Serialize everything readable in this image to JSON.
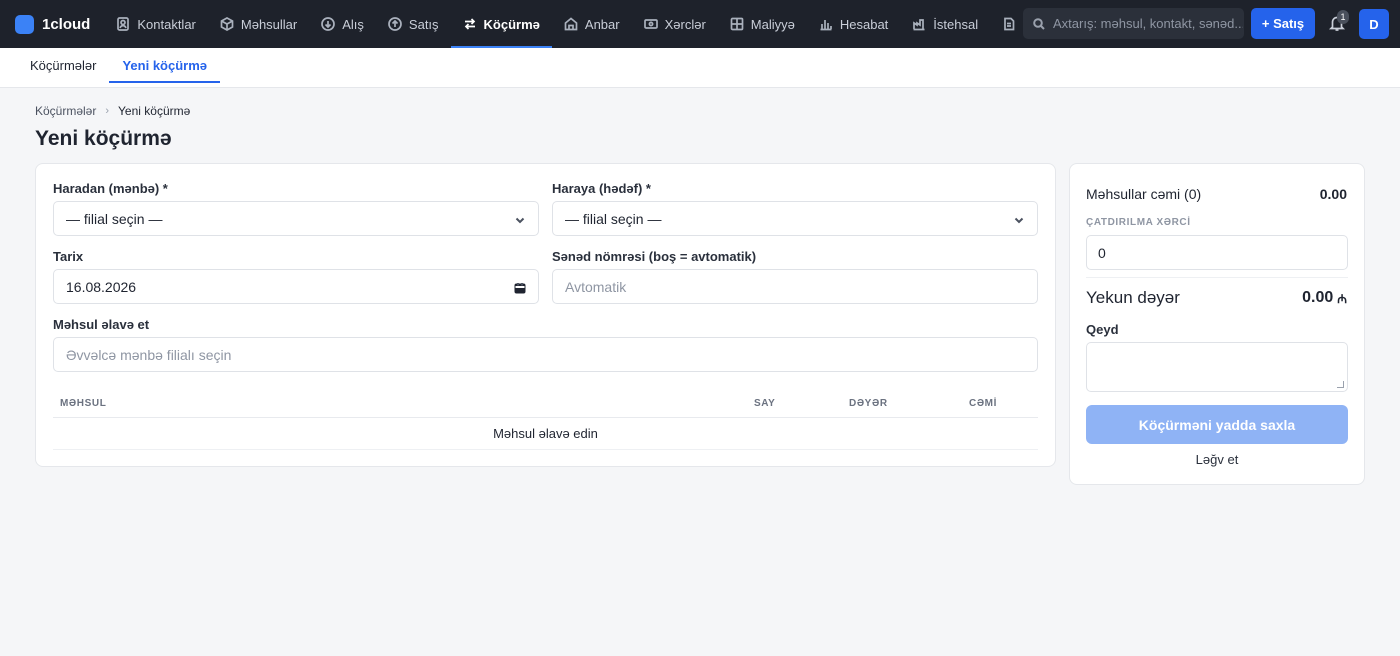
{
  "app": {
    "name": "1cloud"
  },
  "nav": {
    "items": [
      {
        "label": "Kontaktlar",
        "icon": "contacts-icon"
      },
      {
        "label": "Məhsullar",
        "icon": "box-icon"
      },
      {
        "label": "Alış",
        "icon": "purchase-icon"
      },
      {
        "label": "Satış",
        "icon": "sale-icon"
      },
      {
        "label": "Köçürmə",
        "icon": "transfer-icon",
        "active": true
      },
      {
        "label": "Anbar",
        "icon": "warehouse-icon"
      },
      {
        "label": "Xərclər",
        "icon": "expense-icon"
      },
      {
        "label": "Maliyyə",
        "icon": "finance-icon"
      },
      {
        "label": "Hesabat",
        "icon": "report-icon"
      },
      {
        "label": "İstehsal",
        "icon": "production-icon"
      },
      {
        "label": "",
        "icon": "document-icon"
      }
    ],
    "search_placeholder": "Axtarış: məhsul, kontakt, sənəd...",
    "new_sale_label": "+ Satış",
    "notification_count": "1",
    "avatar_initial": "D"
  },
  "subnav": {
    "tabs": [
      {
        "label": "Köçürmələr"
      },
      {
        "label": "Yeni köçürmə",
        "active": true
      }
    ]
  },
  "breadcrumb": {
    "parent": "Köçürmələr",
    "current": "Yeni köçürmə"
  },
  "page_title": "Yeni köçürmə",
  "form": {
    "source_label": "Haradan (mənbə) *",
    "source_value": "— filial seçin —",
    "target_label": "Haraya (hədəf) *",
    "target_value": "— filial seçin —",
    "date_label": "Tarix",
    "date_value": "16.08.2026",
    "docnum_label": "Sənəd nömrəsi (boş = avtomatik)",
    "docnum_placeholder": "Avtomatik",
    "add_product_label": "Məhsul əlavə et",
    "add_product_placeholder": "Əvvəlcə mənbə filialı seçin"
  },
  "table": {
    "headers": {
      "product": "MƏHSUL",
      "qty": "SAY",
      "value": "DƏYƏR",
      "total": "CƏMİ"
    },
    "empty_text": "Məhsul əlavə edin"
  },
  "summary": {
    "products_total_label": "Məhsullar cəmi (0)",
    "products_total_value": "0.00",
    "shipping_label": "ÇATDIRILMA XƏRCİ",
    "shipping_value": "0",
    "final_label": "Yekun dəyər",
    "final_value": "0.00",
    "currency_symbol": "₼",
    "note_label": "Qeyd",
    "save_label": "Köçürməni yadda saxla",
    "cancel_label": "Ləğv et"
  },
  "colors": {
    "nav_bg": "#1e222b",
    "accent": "#2563eb",
    "save_disabled": "#8fb3f5"
  }
}
